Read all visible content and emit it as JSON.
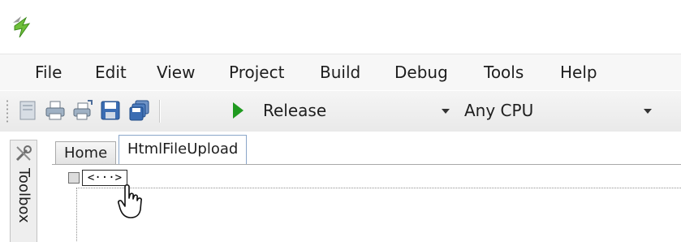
{
  "menu": [
    "File",
    "Edit",
    "View",
    "Project",
    "Build",
    "Debug",
    "Tools",
    "Help"
  ],
  "toolbar": {
    "configuration": "Release",
    "platform": "Any CPU",
    "icons": [
      "page-icon",
      "print-icon",
      "print-preview-icon",
      "save-icon",
      "save-all-icon",
      "start-debug-icon"
    ]
  },
  "toolbox": {
    "label": "Toolbox"
  },
  "tabs": [
    {
      "label": "Home"
    },
    {
      "label": "HtmlFileUpload"
    }
  ],
  "designer": {
    "tag_glyph": "<···>"
  },
  "colors": {
    "run_green": "#1f9a1f",
    "active_tab_border": "#8aa6c9"
  }
}
